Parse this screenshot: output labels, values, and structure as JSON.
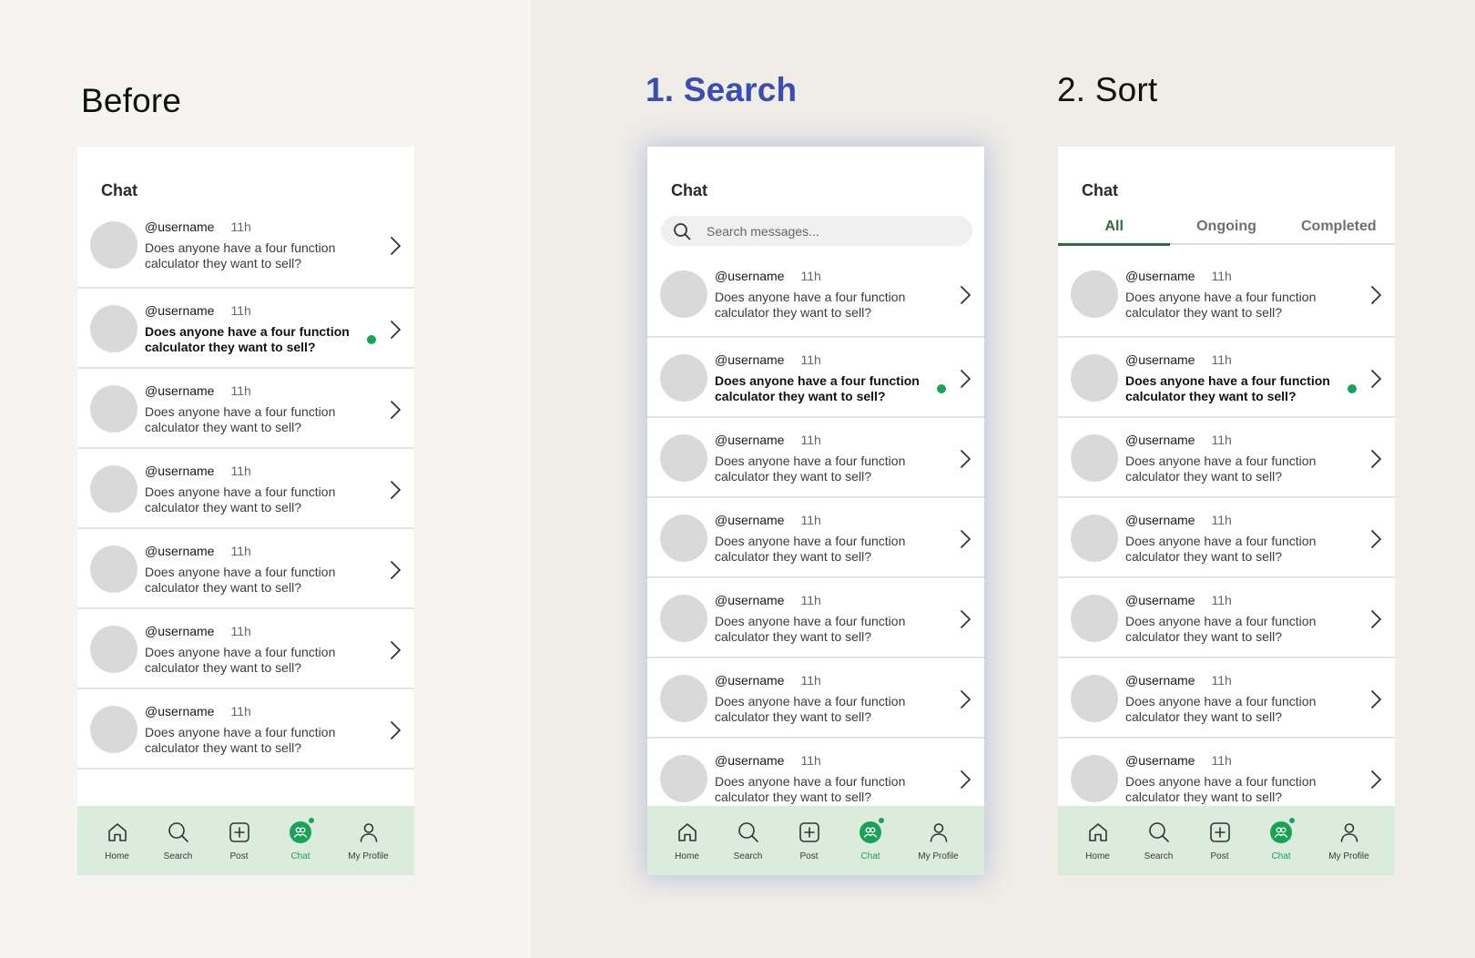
{
  "headings": {
    "before": "Before",
    "search": "1. Search",
    "sort": "2. Sort"
  },
  "colors": {
    "accent_green": "#1aa256",
    "tab_green": "#2f6b3c",
    "search_heading_blue": "#3a4db5",
    "nav_bg": "#dcecdc",
    "avatar_gray": "#d9d9d9"
  },
  "chat": {
    "title": "Chat",
    "item": {
      "username": "@username",
      "time": "11h",
      "message": "Does anyone have a four function calculator they want to sell?"
    }
  },
  "search": {
    "placeholder": "Search messages..."
  },
  "tabs": [
    "All",
    "Ongoing",
    "Completed"
  ],
  "active_tab": "All",
  "unread_item_index": 1,
  "nav": {
    "items": [
      {
        "label": "Home",
        "icon": "home-icon"
      },
      {
        "label": "Search",
        "icon": "search-icon"
      },
      {
        "label": "Post",
        "icon": "plus-square-icon"
      },
      {
        "label": "Chat",
        "icon": "chat-group-icon"
      },
      {
        "label": "My Profile",
        "icon": "person-icon"
      }
    ],
    "active": "Chat"
  }
}
